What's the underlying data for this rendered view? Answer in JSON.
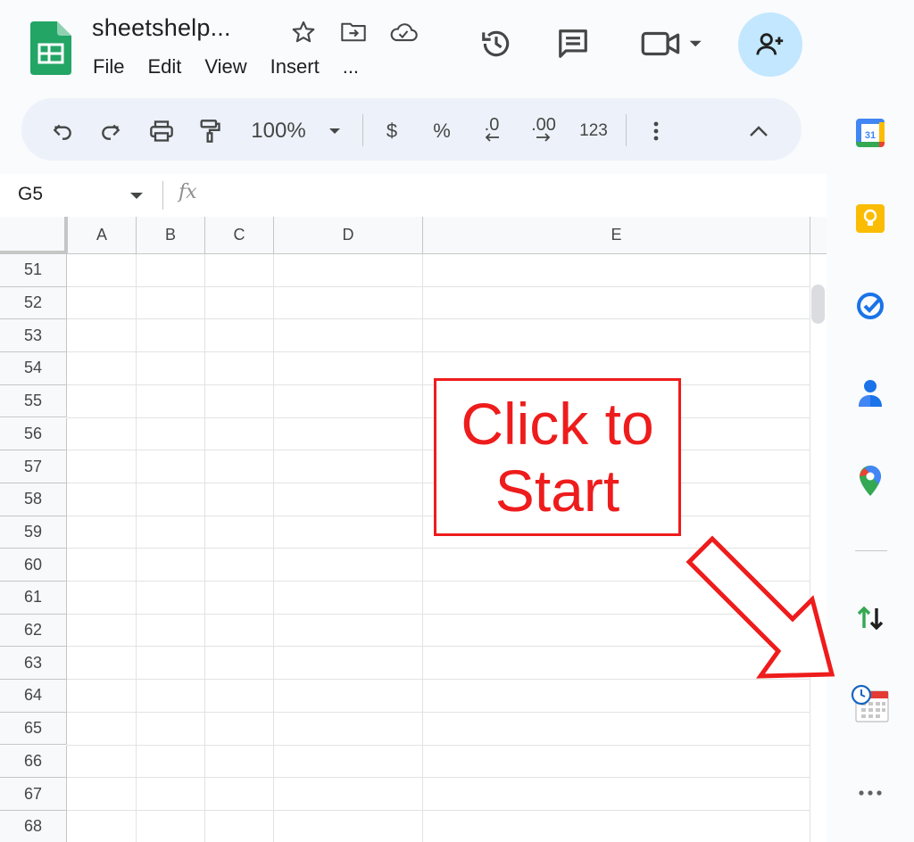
{
  "header": {
    "doc_title": "sheetshelp...",
    "menu": [
      "File",
      "Edit",
      "View",
      "Insert",
      "..."
    ]
  },
  "toolbar": {
    "zoom": "100%",
    "currency": "$",
    "percent": "%",
    "decrease_decimal": ".0",
    "increase_decimal": ".00",
    "number_format": "123"
  },
  "formula_bar": {
    "name_box": "G5",
    "fx": "fx"
  },
  "grid": {
    "columns": [
      "A",
      "B",
      "C",
      "D",
      "E"
    ],
    "rows": [
      "51",
      "52",
      "53",
      "54",
      "55",
      "56",
      "57",
      "58",
      "59",
      "60",
      "61",
      "62",
      "63",
      "64",
      "65",
      "66",
      "67",
      "68"
    ]
  },
  "callout": {
    "line1": "Click to",
    "line2": "Start"
  },
  "colors": {
    "accent": "#0b57d0",
    "callout": "#ee1c1c",
    "sheets_green": "#23a566"
  }
}
